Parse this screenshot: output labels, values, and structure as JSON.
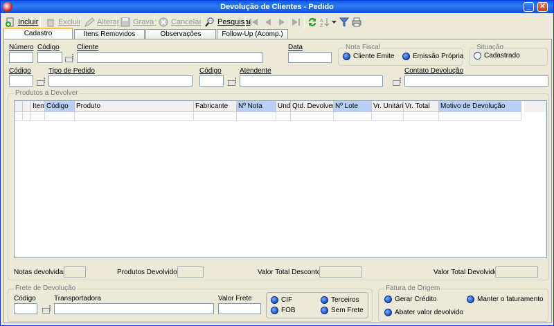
{
  "window": {
    "title": "Devolução de Clientes - Pedido",
    "minimize": "_",
    "close": "✕"
  },
  "toolbar": {
    "incluir": "Incluir",
    "excluir": "Excluir",
    "alterar": "Alterar",
    "gravar": "Gravar",
    "cancelar": "Cancelar",
    "pesquisar": "Pesquisar"
  },
  "tabs": [
    "Cadastro",
    "Itens Removidos",
    "Observações",
    "Follow-Up (Acomp.)"
  ],
  "form": {
    "numero_label": "Número",
    "codigo_label": "Código",
    "cliente_label": "Cliente",
    "data_label": "Data",
    "codigo2_label": "Código",
    "tipo_pedido_label": "Tipo de Pedido",
    "codigo3_label": "Código",
    "atendente_label": "Atendente",
    "contato_label": "Contato Devolução"
  },
  "nota_fiscal": {
    "title": "Nota Fiscal",
    "opt1": "Cliente Emite",
    "opt2": "Emissão Própria"
  },
  "situacao": {
    "title": "Situação",
    "value": "Cadastrado"
  },
  "produtos": {
    "title": "Produtos a Devolver",
    "columns": [
      "Item",
      "Código",
      "Produto",
      "Fabricante",
      "Nº Nota",
      "Und.",
      "Qtd. Devolver",
      "Nº Lote",
      "Vr. Unitário",
      "Vr. Total",
      "Motivo de Devolução"
    ]
  },
  "totais": {
    "notas": "Notas devolvidas:",
    "produtos": "Produtos Devolvidos:",
    "desconto": "Valor Total Desconto:",
    "devolvido": "Valor Total Devolvido:"
  },
  "frete": {
    "title": "Frete de Devolução",
    "codigo_label": "Código",
    "transportadora_label": "Transportadora",
    "valor_label": "Valor Frete",
    "cif": "CIF",
    "fob": "FOB",
    "terceiros": "Terceiros",
    "sem_frete": "Sem Frete"
  },
  "fatura": {
    "title": "Fatura de Origem",
    "gerar": "Gerar Crédito",
    "manter": "Manter o faturamento",
    "abater": "Abater valor devolvido"
  }
}
